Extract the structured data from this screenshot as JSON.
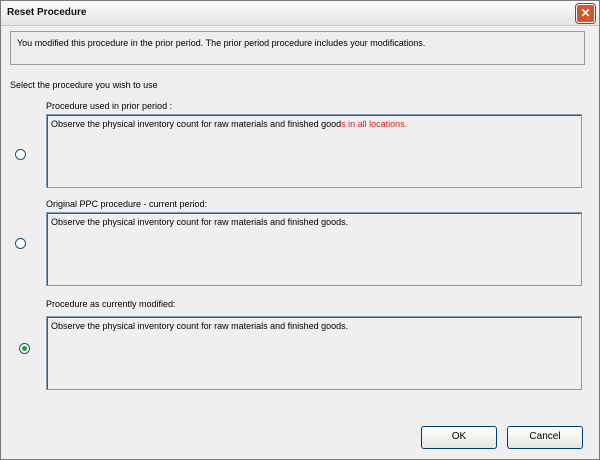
{
  "window": {
    "title": "Reset Procedure",
    "close_glyph": "✕"
  },
  "info": {
    "message": "You modified this procedure in the prior period. The prior period procedure includes your modifications."
  },
  "prompt": "Select the procedure you wish to use",
  "options": [
    {
      "label": "Procedure used in prior period :",
      "text_main": "Observe the physical inventory count for raw materials and finished good",
      "text_highlight": "s in all locations.",
      "selected": false
    },
    {
      "label": "Original PPC procedure - current period:",
      "text_main": "Observe the physical inventory count for raw materials and finished goods.",
      "selected": false
    },
    {
      "label": "Procedure as currently modified:",
      "text_main": "Observe the physical inventory count for raw materials and finished goods.",
      "selected": true
    }
  ],
  "buttons": {
    "ok": "OK",
    "cancel": "Cancel"
  },
  "colors": {
    "highlight_text": "#e21b1b",
    "radio_selected": "#21a121"
  }
}
